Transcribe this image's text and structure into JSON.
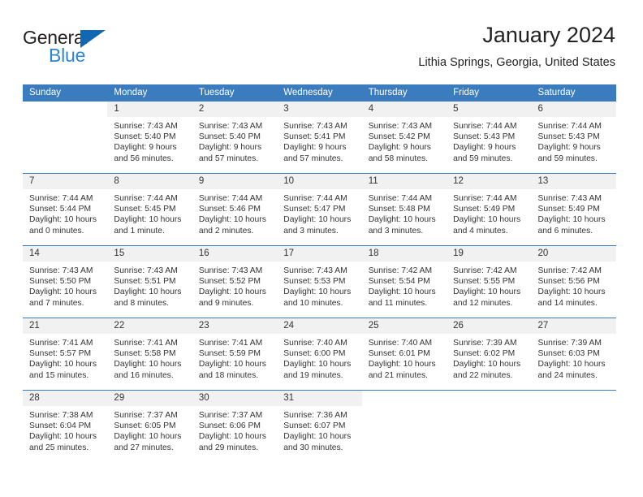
{
  "logo": {
    "line1": "General",
    "line2": "Blue",
    "triangle_color": "#1267b2",
    "blue_text_color": "#2b87d4"
  },
  "header": {
    "title": "January 2024",
    "subtitle": "Lithia Springs, Georgia, United States"
  },
  "theme": {
    "header_blue": "#3a7cbe",
    "daynum_band": "#f1f1f1",
    "text": "#333333"
  },
  "weekday_headers": [
    "Sunday",
    "Monday",
    "Tuesday",
    "Wednesday",
    "Thursday",
    "Friday",
    "Saturday"
  ],
  "weeks": [
    [
      {
        "day": "",
        "empty": true
      },
      {
        "day": "1",
        "sunrise": "Sunrise: 7:43 AM",
        "sunset": "Sunset: 5:40 PM",
        "daylight_1": "Daylight: 9 hours",
        "daylight_2": "and 56 minutes."
      },
      {
        "day": "2",
        "sunrise": "Sunrise: 7:43 AM",
        "sunset": "Sunset: 5:40 PM",
        "daylight_1": "Daylight: 9 hours",
        "daylight_2": "and 57 minutes."
      },
      {
        "day": "3",
        "sunrise": "Sunrise: 7:43 AM",
        "sunset": "Sunset: 5:41 PM",
        "daylight_1": "Daylight: 9 hours",
        "daylight_2": "and 57 minutes."
      },
      {
        "day": "4",
        "sunrise": "Sunrise: 7:43 AM",
        "sunset": "Sunset: 5:42 PM",
        "daylight_1": "Daylight: 9 hours",
        "daylight_2": "and 58 minutes."
      },
      {
        "day": "5",
        "sunrise": "Sunrise: 7:44 AM",
        "sunset": "Sunset: 5:43 PM",
        "daylight_1": "Daylight: 9 hours",
        "daylight_2": "and 59 minutes."
      },
      {
        "day": "6",
        "sunrise": "Sunrise: 7:44 AM",
        "sunset": "Sunset: 5:43 PM",
        "daylight_1": "Daylight: 9 hours",
        "daylight_2": "and 59 minutes."
      }
    ],
    [
      {
        "day": "7",
        "sunrise": "Sunrise: 7:44 AM",
        "sunset": "Sunset: 5:44 PM",
        "daylight_1": "Daylight: 10 hours",
        "daylight_2": "and 0 minutes."
      },
      {
        "day": "8",
        "sunrise": "Sunrise: 7:44 AM",
        "sunset": "Sunset: 5:45 PM",
        "daylight_1": "Daylight: 10 hours",
        "daylight_2": "and 1 minute."
      },
      {
        "day": "9",
        "sunrise": "Sunrise: 7:44 AM",
        "sunset": "Sunset: 5:46 PM",
        "daylight_1": "Daylight: 10 hours",
        "daylight_2": "and 2 minutes."
      },
      {
        "day": "10",
        "sunrise": "Sunrise: 7:44 AM",
        "sunset": "Sunset: 5:47 PM",
        "daylight_1": "Daylight: 10 hours",
        "daylight_2": "and 3 minutes."
      },
      {
        "day": "11",
        "sunrise": "Sunrise: 7:44 AM",
        "sunset": "Sunset: 5:48 PM",
        "daylight_1": "Daylight: 10 hours",
        "daylight_2": "and 3 minutes."
      },
      {
        "day": "12",
        "sunrise": "Sunrise: 7:44 AM",
        "sunset": "Sunset: 5:49 PM",
        "daylight_1": "Daylight: 10 hours",
        "daylight_2": "and 4 minutes."
      },
      {
        "day": "13",
        "sunrise": "Sunrise: 7:43 AM",
        "sunset": "Sunset: 5:49 PM",
        "daylight_1": "Daylight: 10 hours",
        "daylight_2": "and 6 minutes."
      }
    ],
    [
      {
        "day": "14",
        "sunrise": "Sunrise: 7:43 AM",
        "sunset": "Sunset: 5:50 PM",
        "daylight_1": "Daylight: 10 hours",
        "daylight_2": "and 7 minutes."
      },
      {
        "day": "15",
        "sunrise": "Sunrise: 7:43 AM",
        "sunset": "Sunset: 5:51 PM",
        "daylight_1": "Daylight: 10 hours",
        "daylight_2": "and 8 minutes."
      },
      {
        "day": "16",
        "sunrise": "Sunrise: 7:43 AM",
        "sunset": "Sunset: 5:52 PM",
        "daylight_1": "Daylight: 10 hours",
        "daylight_2": "and 9 minutes."
      },
      {
        "day": "17",
        "sunrise": "Sunrise: 7:43 AM",
        "sunset": "Sunset: 5:53 PM",
        "daylight_1": "Daylight: 10 hours",
        "daylight_2": "and 10 minutes."
      },
      {
        "day": "18",
        "sunrise": "Sunrise: 7:42 AM",
        "sunset": "Sunset: 5:54 PM",
        "daylight_1": "Daylight: 10 hours",
        "daylight_2": "and 11 minutes."
      },
      {
        "day": "19",
        "sunrise": "Sunrise: 7:42 AM",
        "sunset": "Sunset: 5:55 PM",
        "daylight_1": "Daylight: 10 hours",
        "daylight_2": "and 12 minutes."
      },
      {
        "day": "20",
        "sunrise": "Sunrise: 7:42 AM",
        "sunset": "Sunset: 5:56 PM",
        "daylight_1": "Daylight: 10 hours",
        "daylight_2": "and 14 minutes."
      }
    ],
    [
      {
        "day": "21",
        "sunrise": "Sunrise: 7:41 AM",
        "sunset": "Sunset: 5:57 PM",
        "daylight_1": "Daylight: 10 hours",
        "daylight_2": "and 15 minutes."
      },
      {
        "day": "22",
        "sunrise": "Sunrise: 7:41 AM",
        "sunset": "Sunset: 5:58 PM",
        "daylight_1": "Daylight: 10 hours",
        "daylight_2": "and 16 minutes."
      },
      {
        "day": "23",
        "sunrise": "Sunrise: 7:41 AM",
        "sunset": "Sunset: 5:59 PM",
        "daylight_1": "Daylight: 10 hours",
        "daylight_2": "and 18 minutes."
      },
      {
        "day": "24",
        "sunrise": "Sunrise: 7:40 AM",
        "sunset": "Sunset: 6:00 PM",
        "daylight_1": "Daylight: 10 hours",
        "daylight_2": "and 19 minutes."
      },
      {
        "day": "25",
        "sunrise": "Sunrise: 7:40 AM",
        "sunset": "Sunset: 6:01 PM",
        "daylight_1": "Daylight: 10 hours",
        "daylight_2": "and 21 minutes."
      },
      {
        "day": "26",
        "sunrise": "Sunrise: 7:39 AM",
        "sunset": "Sunset: 6:02 PM",
        "daylight_1": "Daylight: 10 hours",
        "daylight_2": "and 22 minutes."
      },
      {
        "day": "27",
        "sunrise": "Sunrise: 7:39 AM",
        "sunset": "Sunset: 6:03 PM",
        "daylight_1": "Daylight: 10 hours",
        "daylight_2": "and 24 minutes."
      }
    ],
    [
      {
        "day": "28",
        "sunrise": "Sunrise: 7:38 AM",
        "sunset": "Sunset: 6:04 PM",
        "daylight_1": "Daylight: 10 hours",
        "daylight_2": "and 25 minutes."
      },
      {
        "day": "29",
        "sunrise": "Sunrise: 7:37 AM",
        "sunset": "Sunset: 6:05 PM",
        "daylight_1": "Daylight: 10 hours",
        "daylight_2": "and 27 minutes."
      },
      {
        "day": "30",
        "sunrise": "Sunrise: 7:37 AM",
        "sunset": "Sunset: 6:06 PM",
        "daylight_1": "Daylight: 10 hours",
        "daylight_2": "and 29 minutes."
      },
      {
        "day": "31",
        "sunrise": "Sunrise: 7:36 AM",
        "sunset": "Sunset: 6:07 PM",
        "daylight_1": "Daylight: 10 hours",
        "daylight_2": "and 30 minutes."
      },
      {
        "day": "",
        "empty": true
      },
      {
        "day": "",
        "empty": true
      },
      {
        "day": "",
        "empty": true
      }
    ]
  ]
}
